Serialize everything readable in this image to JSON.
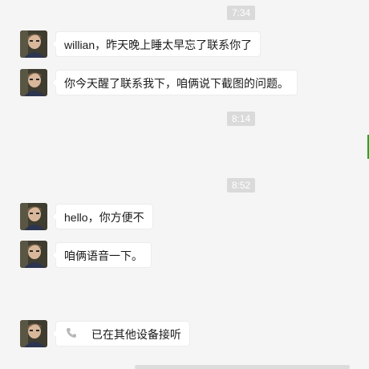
{
  "colors": {
    "background": "#f5f5f5",
    "bubble": "#ffffff",
    "timestamp_bg": "#dadada",
    "accent_green": "#1aad19"
  },
  "timestamps": [
    "7:34",
    "8:14",
    "8:52"
  ],
  "messages": [
    {
      "text": "willian，昨天晚上睡太早忘了联系你了"
    },
    {
      "text": "你今天醒了联系我下，咱俩说下截图的问题。"
    },
    {
      "text": "hello，你方便不"
    },
    {
      "text": "咱俩语音一下。"
    },
    {
      "text": "已在其他设备接听",
      "icon": "phone-icon"
    }
  ]
}
